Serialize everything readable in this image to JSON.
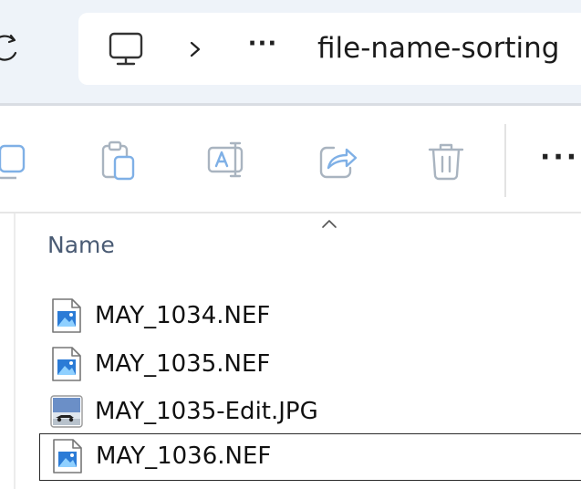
{
  "address_bar": {
    "more_label": "···",
    "folder_name": "file-name-sorting"
  },
  "icons": {
    "refresh": "refresh-icon",
    "location": "this-pc-icon",
    "separator": "chevron-right-icon"
  },
  "toolbar": {
    "buttons": [
      {
        "name": "copy-icon"
      },
      {
        "name": "paste-icon"
      },
      {
        "name": "rename-icon"
      },
      {
        "name": "share-icon"
      },
      {
        "name": "delete-icon"
      }
    ],
    "more_label": "···"
  },
  "file_list": {
    "column_header": "Name",
    "files": [
      {
        "name": "MAY_1034.NEF",
        "icon": "nef-image-file-icon",
        "selected": false
      },
      {
        "name": "MAY_1035.NEF",
        "icon": "nef-image-file-icon",
        "selected": false
      },
      {
        "name": "MAY_1035-Edit.JPG",
        "icon": "jpg-thumbnail-icon",
        "selected": false
      },
      {
        "name": "MAY_1036.NEF",
        "icon": "nef-image-file-icon",
        "selected": true
      }
    ]
  },
  "colors": {
    "address_strip_bg": "#eef3f9",
    "disabled_icon": "#a9b4c0",
    "accent_blue": "#2b7bd6",
    "header_text": "#4a5b74"
  }
}
